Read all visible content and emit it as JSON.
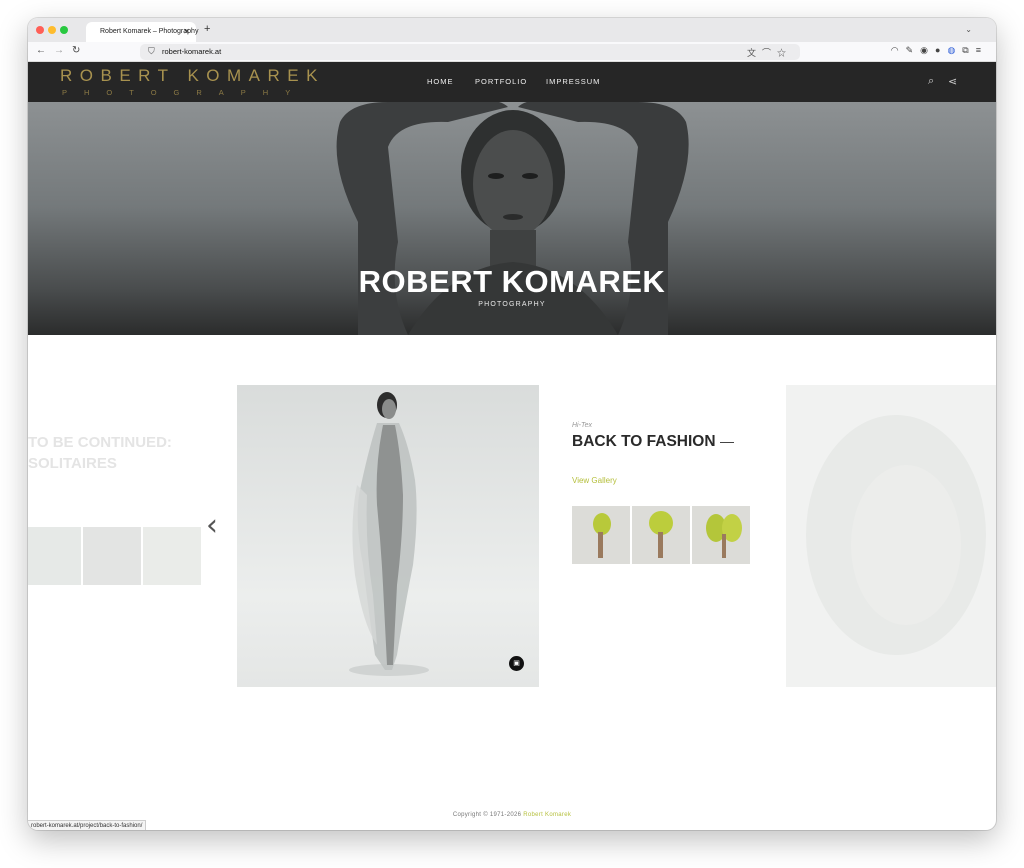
{
  "browser": {
    "tab_title": "Robert Komarek – Photography",
    "tab_close": "✕",
    "new_tab": "+",
    "url": "robert-komarek.at",
    "status_url": "robert-komarek.at/project/back-to-fashion/"
  },
  "site": {
    "logo_main": "ROBERT KOMAREK",
    "logo_sub": "PHOTOGRAPHY",
    "nav": [
      "HOME",
      "PORTFOLIO",
      "IMPRESSUM"
    ],
    "hero_title": "ROBERT KOMAREK",
    "hero_subtitle": "PHOTOGRAPHY"
  },
  "carousel": {
    "prev_title_line1": "TO BE CONTINUED:",
    "prev_title_line2": "SOLITAIRES",
    "current": {
      "category": "Hi-Tex",
      "title": "BACK TO FASHION",
      "link": "View Gallery"
    },
    "prev_arrow": "‹",
    "next_arrow": "›"
  },
  "footer": {
    "copyright": "Copyright © 1971-2026 ",
    "owner": "Robert Komarek"
  },
  "colors": {
    "logo_gold": "#a8924f",
    "accent_green": "#b5bf3c",
    "header_bg": "#262626"
  }
}
